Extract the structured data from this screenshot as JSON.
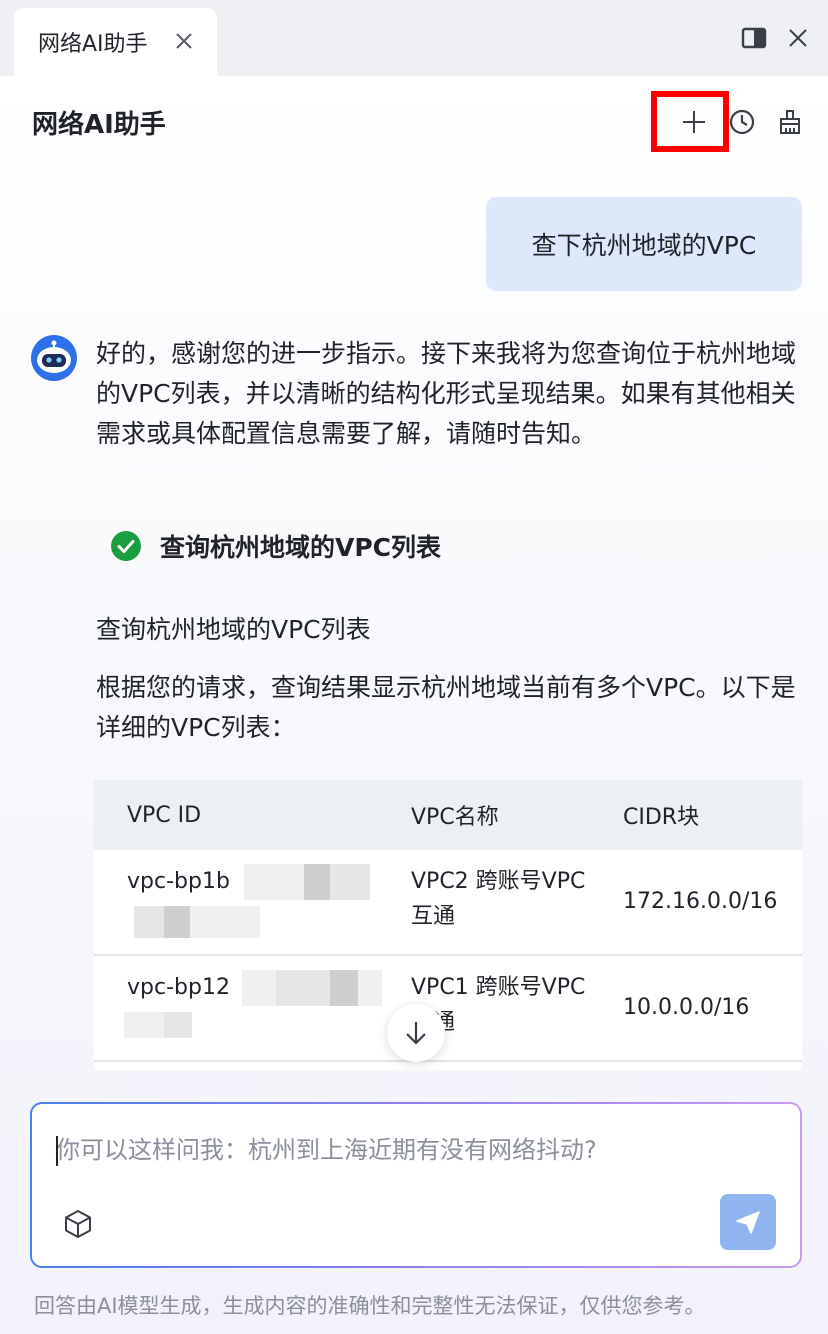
{
  "tab": {
    "title": "网络AI助手"
  },
  "header": {
    "title": "网络AI助手"
  },
  "conversation": {
    "user_message": "查下杭州地域的VPC",
    "assistant_intro": "好的，感谢您的进一步指示。接下来我将为您查询位于杭州地域的VPC列表，并以清晰的结构化形式呈现结果。如果有其他相关需求或具体配置信息需要了解，请随时告知。",
    "step": {
      "label": "查询杭州地域的VPC列表",
      "status": "done",
      "status_color": "#1a9e3f"
    },
    "section_title": "查询杭州地域的VPC列表",
    "result_text": "根据您的请求，查询结果显示杭州地域当前有多个VPC。以下是详细的VPC列表："
  },
  "table": {
    "headers": [
      "VPC ID",
      "VPC名称",
      "CIDR块"
    ],
    "rows": [
      {
        "id": "vpc-bp1b",
        "name": "VPC2 跨账号VPC互通",
        "cidr": "172.16.0.0/16"
      },
      {
        "id": "vpc-bp12",
        "name": "VPC1 跨账号VPC互通",
        "cidr": "10.0.0.0/16"
      }
    ]
  },
  "input": {
    "placeholder": "你可以这样问我：杭州到上海近期有没有网络抖动?"
  },
  "footer": {
    "disclaimer": "回答由AI模型生成，生成内容的准确性和完整性无法保证，仅供您参考。"
  },
  "colors": {
    "accent": "#4a7ff0",
    "user_bubble": "#dde9fb",
    "send_button": "#8fb4ef",
    "highlight": "#ff0000"
  },
  "icons": [
    "close-icon",
    "panel-toggle-icon",
    "plus-icon",
    "clock-icon",
    "broom-icon",
    "robot-avatar-icon",
    "check-circle-icon",
    "arrow-down-icon",
    "cube-icon",
    "send-icon"
  ]
}
